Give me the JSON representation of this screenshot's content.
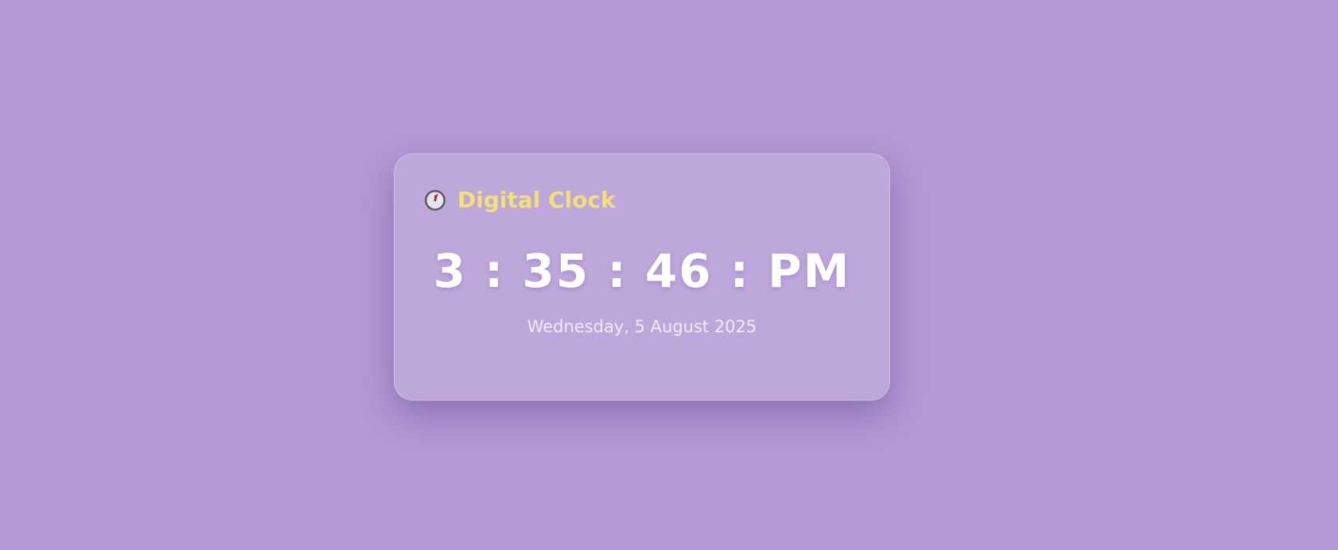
{
  "widget": {
    "icon": "stopwatch-clock-icon",
    "title": "Digital Clock",
    "time": "3 : 35 : 46 : PM",
    "date": "Wednesday, 5 August 2025"
  },
  "colors": {
    "background": "#b399d6",
    "title": "#f3e07a",
    "time": "#ffffff",
    "date": "#f1ecf8"
  }
}
